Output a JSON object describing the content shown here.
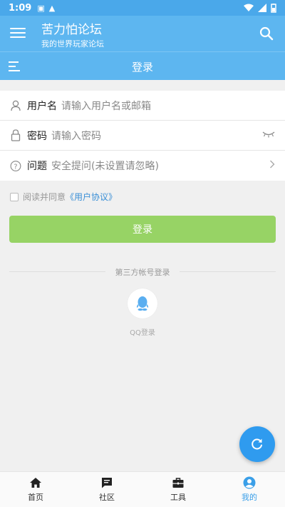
{
  "statusbar": {
    "time": "1:09"
  },
  "appbar": {
    "title": "苦力怕论坛",
    "subtitle": "我的世界玩家论坛"
  },
  "subbar": {
    "title": "登录"
  },
  "form": {
    "username": {
      "label": "用户名",
      "placeholder": "请输入用户名或邮箱"
    },
    "password": {
      "label": "密码",
      "placeholder": "请输入密码"
    },
    "question": {
      "label": "问题",
      "placeholder": "安全提问(未设置请忽略)"
    }
  },
  "agreement": {
    "text": "阅读并同意",
    "link": "《用户协议》"
  },
  "login_button": "登录",
  "third_party": {
    "title": "第三方帐号登录",
    "qq_label": "QQ登录"
  },
  "bottom_nav": [
    {
      "label": "首页",
      "icon": "home-icon"
    },
    {
      "label": "社区",
      "icon": "chat-icon"
    },
    {
      "label": "工具",
      "icon": "toolbox-icon"
    },
    {
      "label": "我的",
      "icon": "user-icon"
    }
  ],
  "colors": {
    "primary": "#5db6f0",
    "login_button": "#97d365",
    "fab": "#2f9bef",
    "active_tab": "#3a9fe8"
  }
}
